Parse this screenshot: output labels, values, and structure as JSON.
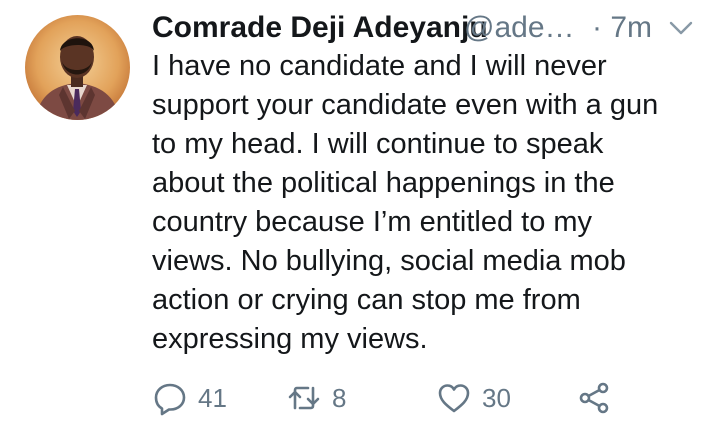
{
  "tweet": {
    "author_name": "Comrade Deji Adeyanju",
    "handle": "@ade…",
    "separator_time": "· 7m",
    "text_lines": [
      "I have no candidate and I will never",
      "support your candidate even with a gun",
      "to my head. I will continue to speak",
      "about the political happenings in the",
      "country because I’m entitled to my",
      "views. No bullying, social media mob",
      "action or crying can stop me from",
      "expressing my views."
    ],
    "reply_count": "41",
    "retweet_count": "8",
    "like_count": "30"
  },
  "icons": {
    "reply": "reply-icon",
    "retweet": "retweet-icon",
    "like": "heart-icon",
    "share": "share-icon",
    "caret": "chevron-down-icon"
  },
  "colors": {
    "text": "#14171a",
    "secondary": "#657786"
  }
}
